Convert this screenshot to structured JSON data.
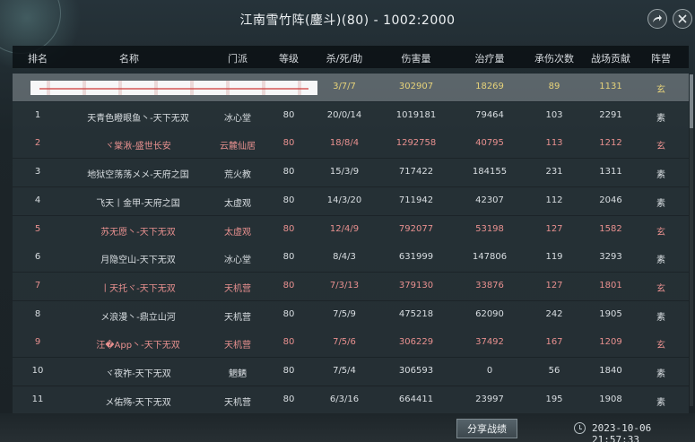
{
  "title": "江南雪竹阵(鏖斗)(80) - 1002:2000",
  "columns": [
    "排名",
    "名称",
    "门派",
    "等级",
    "杀/死/助",
    "伤害量",
    "治疗量",
    "承伤次数",
    "战场贡献",
    "阵营"
  ],
  "self_row": {
    "rank": "",
    "name": "",
    "sect": "",
    "level": "",
    "kda": "3/7/7",
    "damage": "302907",
    "heal": "18269",
    "hits": "89",
    "contribution": "1131",
    "camp": "玄"
  },
  "rows": [
    {
      "rank": "1",
      "name": "天青色瞪眼鱼丶-天下无双",
      "sect": "冰心堂",
      "level": "80",
      "kda": "20/0/14",
      "damage": "1019181",
      "heal": "79464",
      "hits": "103",
      "contribution": "2291",
      "camp": "素",
      "color": "white"
    },
    {
      "rank": "2",
      "name": "ヾ棠湫-盛世长安",
      "sect": "云麓仙居",
      "level": "80",
      "kda": "18/8/4",
      "damage": "1292758",
      "heal": "40795",
      "hits": "113",
      "contribution": "1212",
      "camp": "玄",
      "color": "red"
    },
    {
      "rank": "3",
      "name": "地狱空荡荡メメ-天府之国",
      "sect": "荒火教",
      "level": "80",
      "kda": "15/3/9",
      "damage": "717422",
      "heal": "184155",
      "hits": "231",
      "contribution": "1311",
      "camp": "素",
      "color": "white"
    },
    {
      "rank": "4",
      "name": "飞天丨金甲-天府之国",
      "sect": "太虚观",
      "level": "80",
      "kda": "14/3/20",
      "damage": "711942",
      "heal": "42307",
      "hits": "112",
      "contribution": "2046",
      "camp": "素",
      "color": "white"
    },
    {
      "rank": "5",
      "name": "苏无愿丶-天下无双",
      "sect": "太虚观",
      "level": "80",
      "kda": "12/4/9",
      "damage": "792077",
      "heal": "53198",
      "hits": "127",
      "contribution": "1582",
      "camp": "玄",
      "color": "red"
    },
    {
      "rank": "6",
      "name": "月隐空山-天下无双",
      "sect": "冰心堂",
      "level": "80",
      "kda": "8/4/3",
      "damage": "631999",
      "heal": "147806",
      "hits": "119",
      "contribution": "3293",
      "camp": "素",
      "color": "white"
    },
    {
      "rank": "7",
      "name": "丨天托ヾ-天下无双",
      "sect": "天机营",
      "level": "80",
      "kda": "7/3/13",
      "damage": "379130",
      "heal": "33876",
      "hits": "127",
      "contribution": "1801",
      "camp": "玄",
      "color": "red"
    },
    {
      "rank": "8",
      "name": "メ浪漫丶-鼎立山河",
      "sect": "天机营",
      "level": "80",
      "kda": "7/5/9",
      "damage": "475218",
      "heal": "62090",
      "hits": "242",
      "contribution": "1905",
      "camp": "素",
      "color": "white"
    },
    {
      "rank": "9",
      "name": "汪�App丶-天下无双",
      "sect": "天机营",
      "level": "80",
      "kda": "7/5/6",
      "damage": "306229",
      "heal": "37492",
      "hits": "167",
      "contribution": "1209",
      "camp": "玄",
      "color": "red"
    },
    {
      "rank": "10",
      "name": "ヾ夜祚-天下无双",
      "sect": "魍魉",
      "level": "80",
      "kda": "7/5/4",
      "damage": "306593",
      "heal": "0",
      "hits": "56",
      "contribution": "1840",
      "camp": "素",
      "color": "white"
    },
    {
      "rank": "11",
      "name": "メ佑殇-天下无双",
      "sect": "天机营",
      "level": "80",
      "kda": "6/3/16",
      "damage": "664411",
      "heal": "23997",
      "hits": "195",
      "contribution": "1908",
      "camp": "素",
      "color": "white"
    }
  ],
  "share_button_label": "分享战绩",
  "timestamp": "2023-10-06 21:57:33",
  "icons": {
    "share": "share-icon",
    "close": "close-icon",
    "clock": "clock-icon"
  },
  "colors": {
    "enemy_red": "#e8908f",
    "ally_white": "#d9dee2",
    "self_gold": "#e6d27a"
  }
}
